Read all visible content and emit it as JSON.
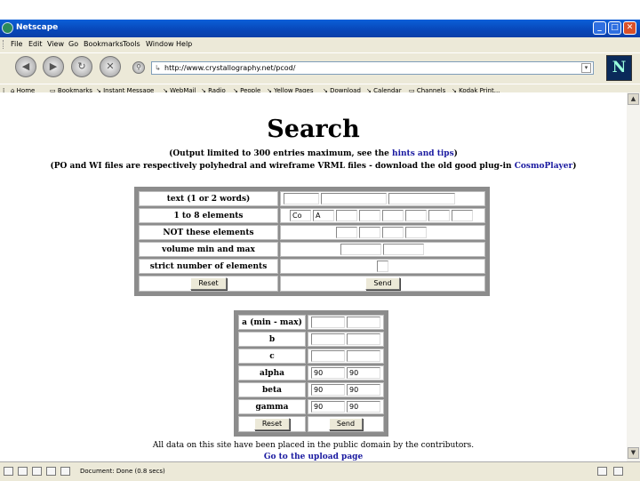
{
  "window": {
    "title": "Netscape"
  },
  "menu": [
    "File",
    "Edit",
    "View",
    "Go",
    "Bookmarks",
    "Tools",
    "Window",
    "Help"
  ],
  "nav": {
    "url": "http://www.crystallography.net/pcod/"
  },
  "bookmarks": [
    "Home",
    "Bookmarks",
    "Instant Message",
    "WebMail",
    "Radio",
    "People",
    "Yellow Pages",
    "Download",
    "Calendar",
    "Channels",
    "Kodak Print..."
  ],
  "page": {
    "title": "Search",
    "note1_prefix": "(Output limited to 300 entries maximum, see the ",
    "note1_link": "hints and tips",
    "note1_suffix": ")",
    "note2_prefix": "(PO and WI files are respectively polyhedral and wireframe VRML files - download the old good plug-in ",
    "note2_link": "CosmoPlayer",
    "note2_suffix": ")",
    "form1": {
      "text_label": "text (1 or 2 words)",
      "elements_label": "1 to 8 elements",
      "element1": "Co",
      "element2": "A",
      "not_label": "NOT these elements",
      "volume_label": "volume min and max",
      "strict_label": "strict number of elements",
      "reset": "Reset",
      "send": "Send"
    },
    "form2": {
      "a_label": "a (min - max)",
      "b_label": "b",
      "c_label": "c",
      "alpha_label": "alpha",
      "alpha_min": "90",
      "alpha_max": "90",
      "beta_label": "beta",
      "beta_min": "90",
      "beta_max": "90",
      "gamma_label": "gamma",
      "gamma_min": "90",
      "gamma_max": "90",
      "reset": "Reset",
      "send": "Send"
    },
    "footer_text": "All data on this site have been placed in the public domain by the contributors.",
    "footer_link": "Go to the upload page"
  },
  "status": {
    "text": "Document: Done (0.8 secs)"
  }
}
